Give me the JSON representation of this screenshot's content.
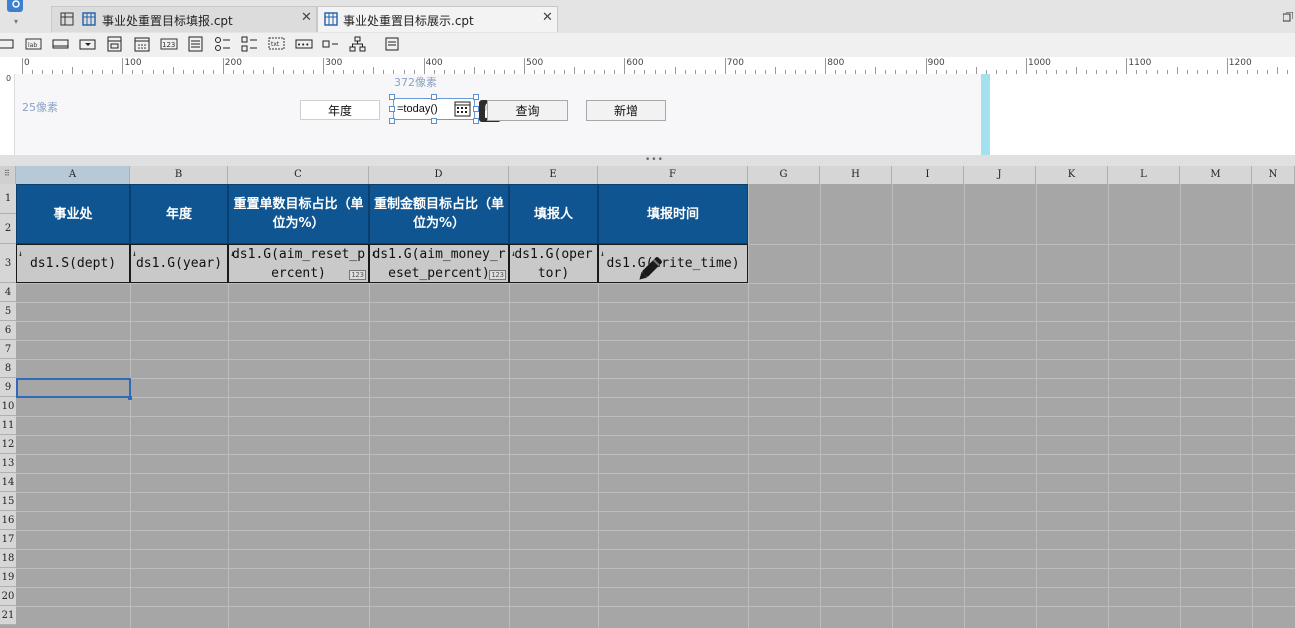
{
  "tabs": [
    {
      "label": "事业处重置目标填报.cpt",
      "active": false
    },
    {
      "label": "事业处重置目标展示.cpt",
      "active": true
    }
  ],
  "tab_close_symbol": "✕",
  "ruler": {
    "labels": [
      "0",
      "100",
      "200",
      "300",
      "400",
      "500",
      "600",
      "700",
      "800",
      "900",
      "1000",
      "1100",
      "1200"
    ]
  },
  "param_panel": {
    "height_label": "25像素",
    "width_label": "372像素",
    "year_label": "年度",
    "date_value": "=today()",
    "query_button": "查询",
    "add_button": "新增"
  },
  "splitter_grip": "•••",
  "columns": [
    "A",
    "B",
    "C",
    "D",
    "E",
    "F",
    "G",
    "H",
    "I",
    "J",
    "K",
    "L",
    "M",
    "N"
  ],
  "rows": [
    "1",
    "2",
    "3",
    "4",
    "5",
    "6",
    "7",
    "8",
    "9",
    "10",
    "11",
    "12",
    "13",
    "14",
    "15",
    "16",
    "17",
    "18",
    "19",
    "20",
    "21"
  ],
  "report": {
    "headers": [
      "事业处",
      "年度",
      "重置单数目标占比（单位为%）",
      "重制金额目标占比（单位为%）",
      "填报人",
      "填报时间"
    ],
    "cells": [
      "ds1.S(dept)",
      "ds1.G(year)",
      "ds1.G(aim_reset_percent)",
      "ds1.G(aim_money_reset_percent)",
      "ds1.G(opertor)",
      "ds1.G(write_time)"
    ],
    "badge": "123"
  },
  "colors": {
    "header_fill": "#0e5591",
    "header_text": "#ffffff",
    "grid_bg": "#a6a6a6",
    "selection": "#2f6ab8"
  },
  "icons": [
    "app-logo-icon",
    "report-template-icon",
    "close-icon",
    "calendar-icon",
    "lock-icon",
    "edit-pen-icon"
  ]
}
